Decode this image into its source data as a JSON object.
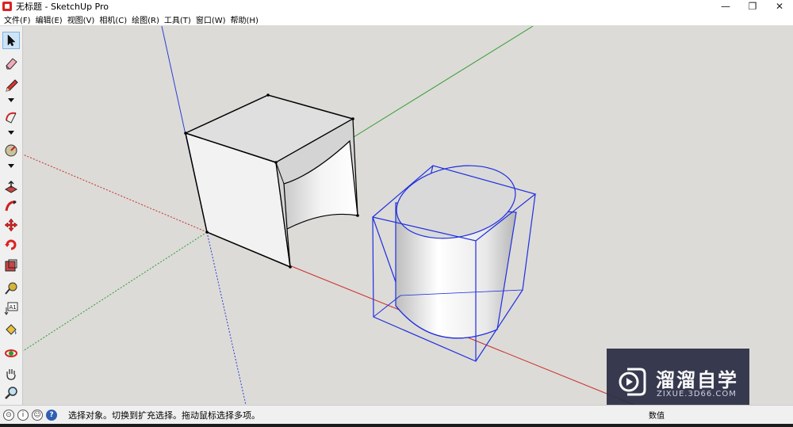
{
  "window": {
    "title": "无标题 - SketchUp Pro",
    "minimize_glyph": "—",
    "restore_glyph": "❐",
    "close_glyph": "✕"
  },
  "menu": {
    "items": [
      "文件(F)",
      "编辑(E)",
      "视图(V)",
      "相机(C)",
      "绘图(R)",
      "工具(T)",
      "窗口(W)",
      "帮助(H)"
    ]
  },
  "toolbar": {
    "tools": [
      {
        "name": "select-tool",
        "icon": "arrow-cursor-icon",
        "active": true
      },
      {
        "name": "eraser-tool",
        "icon": "eraser-icon"
      },
      {
        "name": "pencil-tool",
        "icon": "pencil-icon"
      },
      {
        "name": "arc-tool",
        "icon": "arc-icon"
      },
      {
        "name": "compass-tool",
        "icon": "compass-icon"
      },
      {
        "name": "push-pull-tool",
        "icon": "push-pull-icon"
      },
      {
        "name": "follow-me-tool",
        "icon": "follow-me-icon"
      },
      {
        "name": "move-tool",
        "icon": "move-arrows-icon"
      },
      {
        "name": "rotate-tool",
        "icon": "rotate-icon"
      },
      {
        "name": "scale-tool",
        "icon": "scale-icon"
      },
      {
        "name": "tape-measure-tool",
        "icon": "tape-measure-icon"
      },
      {
        "name": "text-tool",
        "icon": "text-a1-icon",
        "label": "A1"
      },
      {
        "name": "paint-bucket-tool",
        "icon": "paint-bucket-icon"
      },
      {
        "name": "orbit-tool",
        "icon": "orbit-icon"
      },
      {
        "name": "pan-tool",
        "icon": "hand-icon"
      },
      {
        "name": "zoom-tool",
        "icon": "magnifier-icon"
      }
    ]
  },
  "status": {
    "message": "选择对象。切换到扩充选择。拖动鼠标选择多项。",
    "measurements_label": "数值",
    "help_glyph": "?"
  },
  "watermark": {
    "title": "溜溜自学",
    "url": "ZIXUE.3D66.COM"
  },
  "colors": {
    "viewport_bg": "#dcdbd7",
    "axis_red": "#cc2a2a",
    "axis_green": "#2e9b2e",
    "axis_blue": "#2a3fd6",
    "selection_blue": "#1f2fe0"
  }
}
